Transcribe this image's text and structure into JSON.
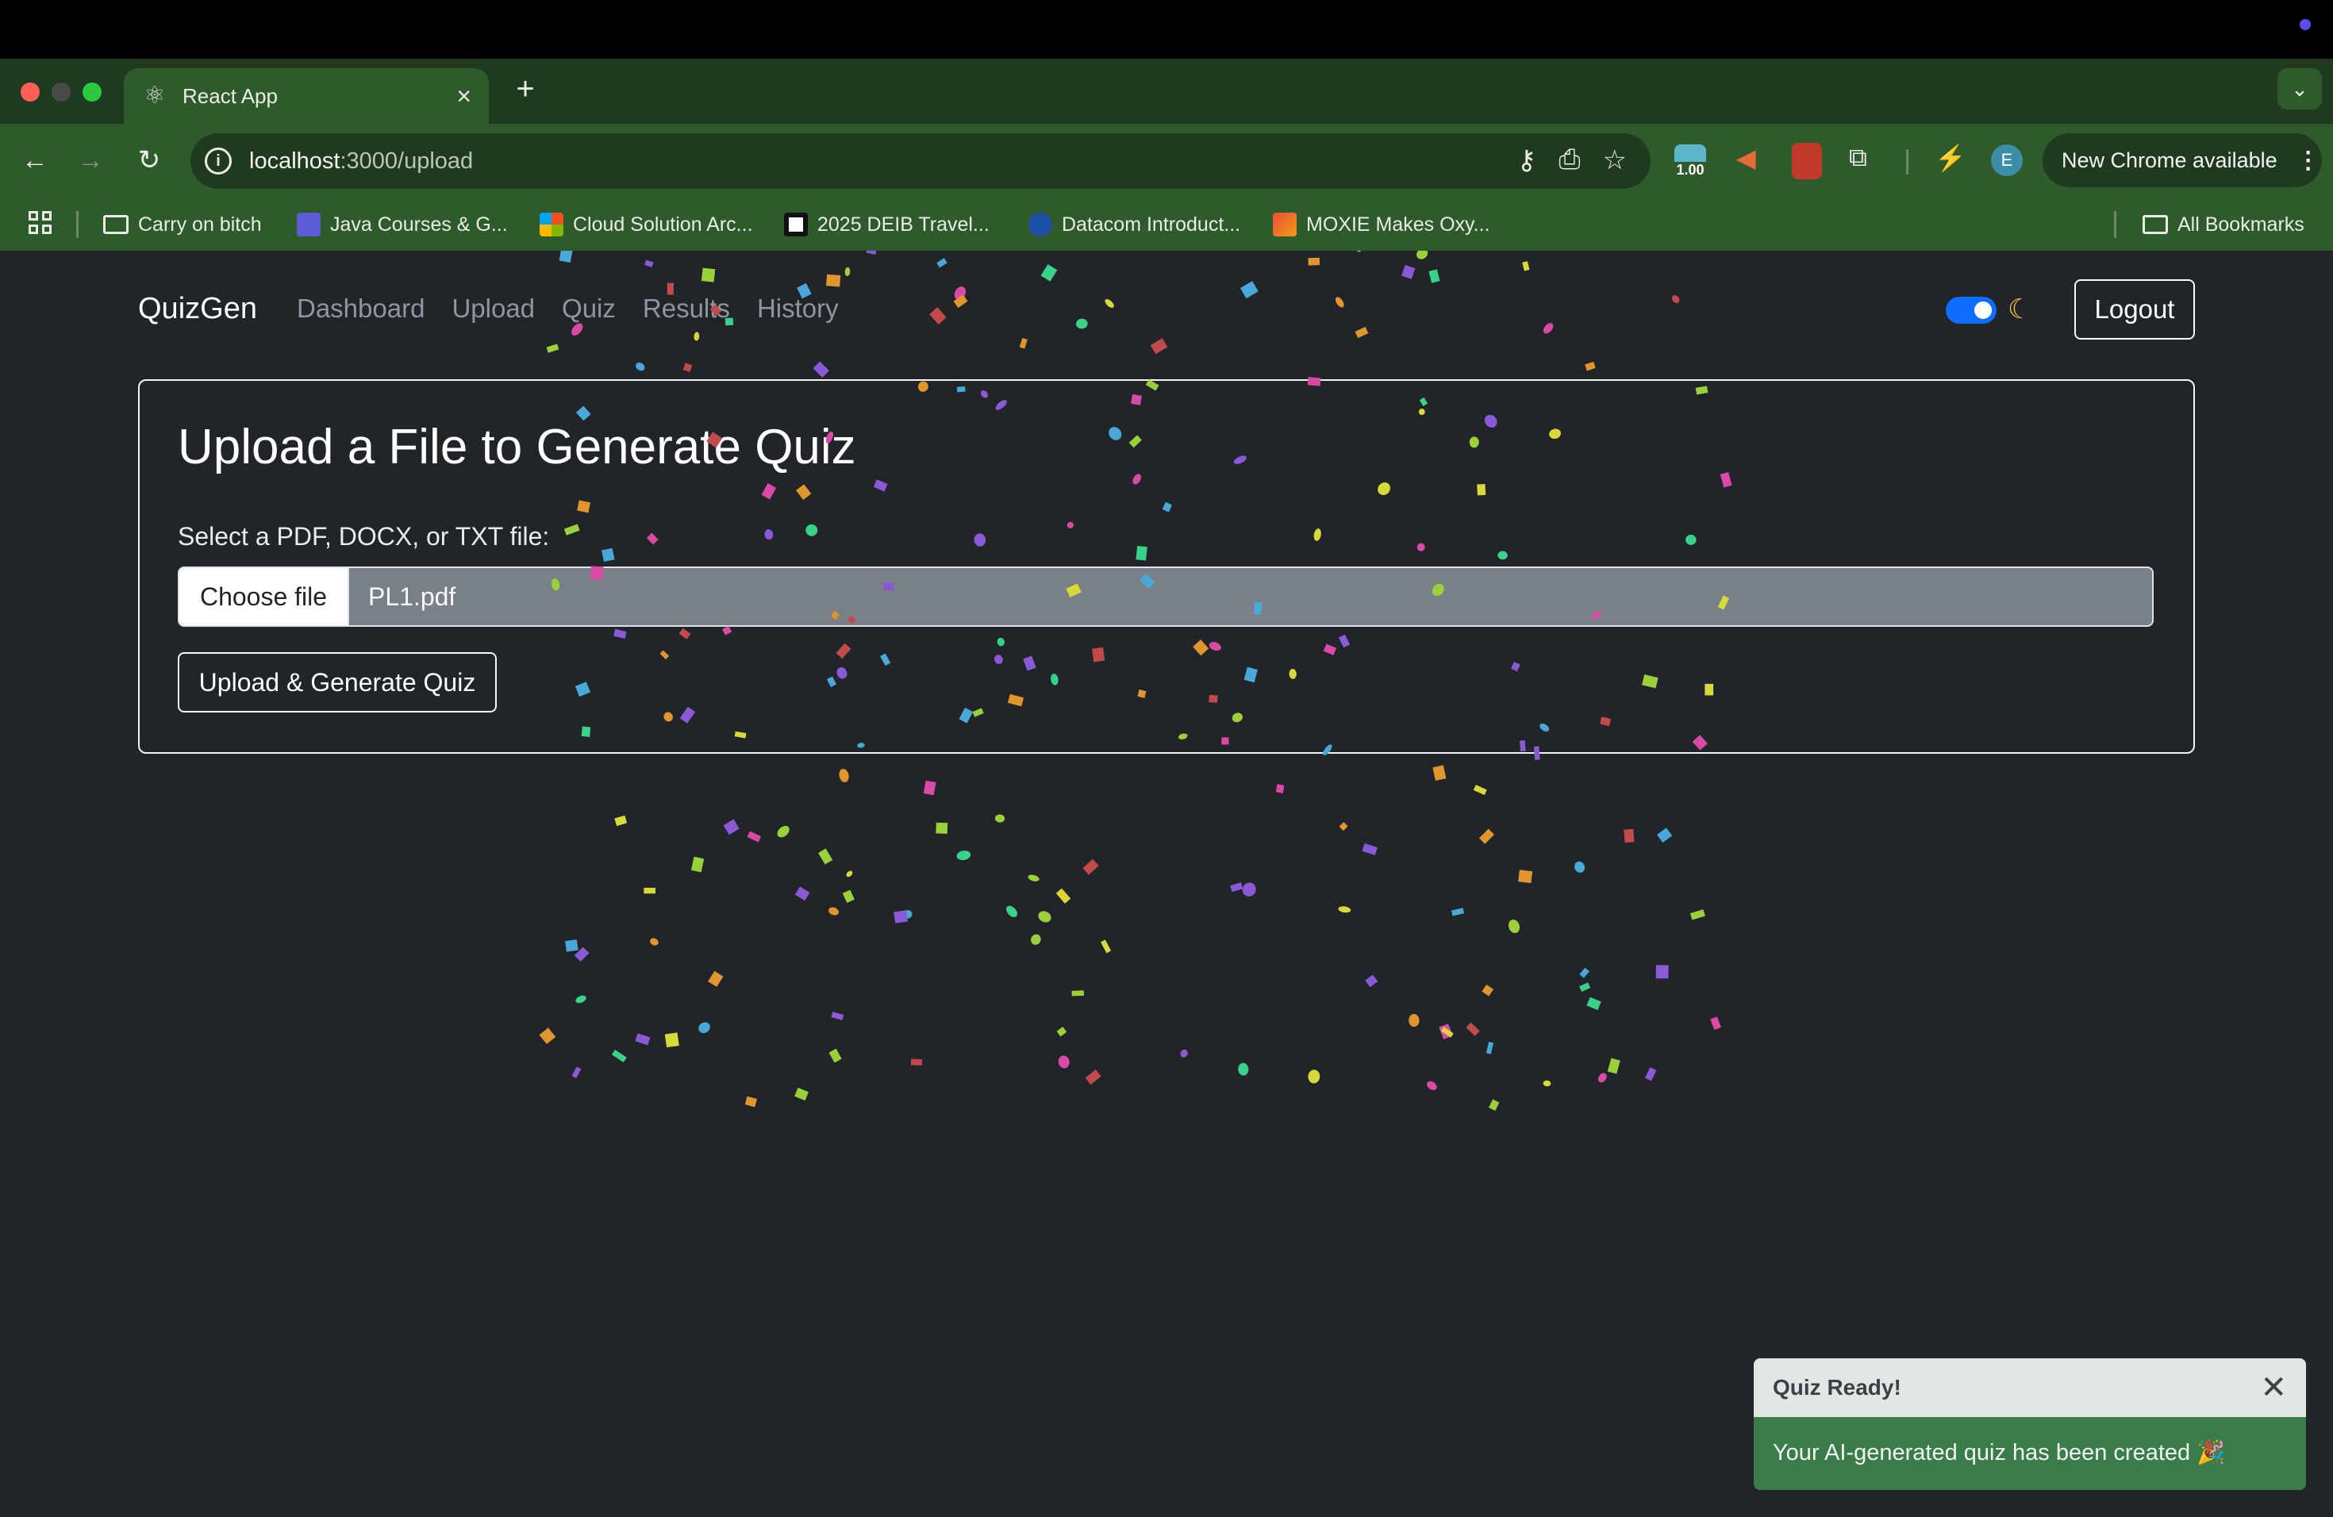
{
  "browser": {
    "tab_title": "React App",
    "url_host": "localhost",
    "url_path": ":3000/upload",
    "extension_badge": "1.00",
    "profile_initial": "E",
    "update_label": "New Chrome available",
    "bookmarks": [
      {
        "label": "Carry on bitch",
        "icon": "folder-icon"
      },
      {
        "label": "Java Courses & G...",
        "icon": "terminal-icon"
      },
      {
        "label": "Cloud Solution Arc...",
        "icon": "microsoft-icon"
      },
      {
        "label": "2025 DEIB Travel...",
        "icon": "document-icon"
      },
      {
        "label": "Datacom Introduct...",
        "icon": "datacom-icon"
      },
      {
        "label": "MOXIE Makes Oxy...",
        "icon": "moxie-icon"
      }
    ],
    "all_bookmarks_label": "All Bookmarks"
  },
  "navbar": {
    "brand": "QuizGen",
    "links": [
      "Dashboard",
      "Upload",
      "Quiz",
      "Results",
      "History"
    ],
    "theme_toggle_on": true,
    "logout_label": "Logout"
  },
  "upload_card": {
    "title": "Upload a File to Generate Quiz",
    "field_label": "Select a PDF, DOCX, or TXT file:",
    "choose_file_label": "Choose file",
    "selected_file": "PL1.pdf",
    "submit_label": "Upload & Generate Quiz"
  },
  "toast": {
    "title": "Quiz Ready!",
    "message": "Your AI-generated quiz has been created 🎉"
  },
  "colors": {
    "page_bg": "#212529",
    "chrome_dark": "#1f3a1e",
    "chrome_mid": "#2f5a2c",
    "toggle_accent": "#0d6efd",
    "toast_body": "#3a7d4a"
  }
}
